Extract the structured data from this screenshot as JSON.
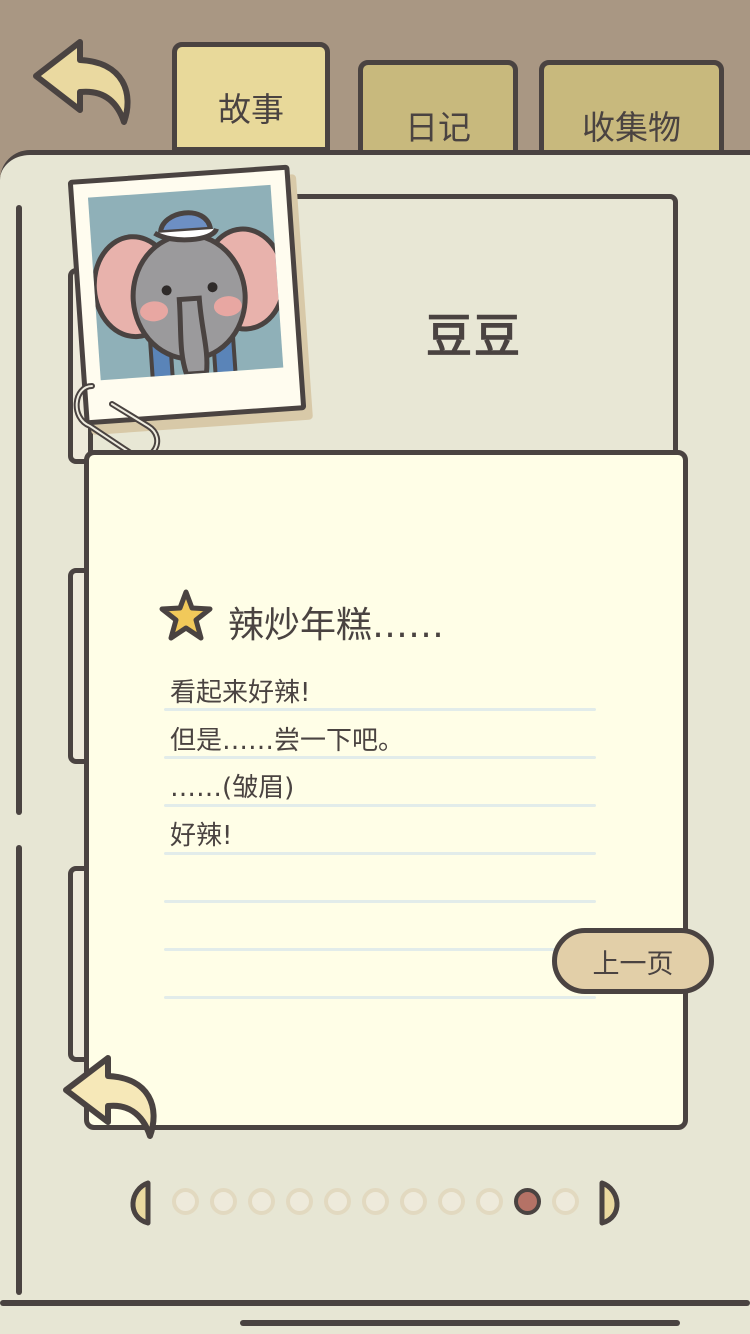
{
  "tabs": [
    {
      "label": "故事",
      "active": true
    },
    {
      "label": "日记",
      "active": false
    },
    {
      "label": "收集物",
      "active": false
    }
  ],
  "character": {
    "name": "豆豆",
    "photo_icon": "elephant-portrait"
  },
  "note": {
    "title": "辣炒年糕……",
    "title_icon": "star-icon",
    "lines": [
      "看起来好辣!",
      "但是……尝一下吧。",
      "……(皱眉)",
      "好辣!"
    ]
  },
  "buttons": {
    "prev_page": "上一页"
  },
  "pager": {
    "total_pages": 11,
    "current_page": 10
  },
  "colors": {
    "background_top": "#a99783",
    "book": "#e7e6d4",
    "note": "#fffee7",
    "tab": "#c8b97d",
    "tab_active": "#e8d99a",
    "outline": "#4a4341",
    "button": "#e2cfa8",
    "page_dot_active": "#b57266"
  }
}
